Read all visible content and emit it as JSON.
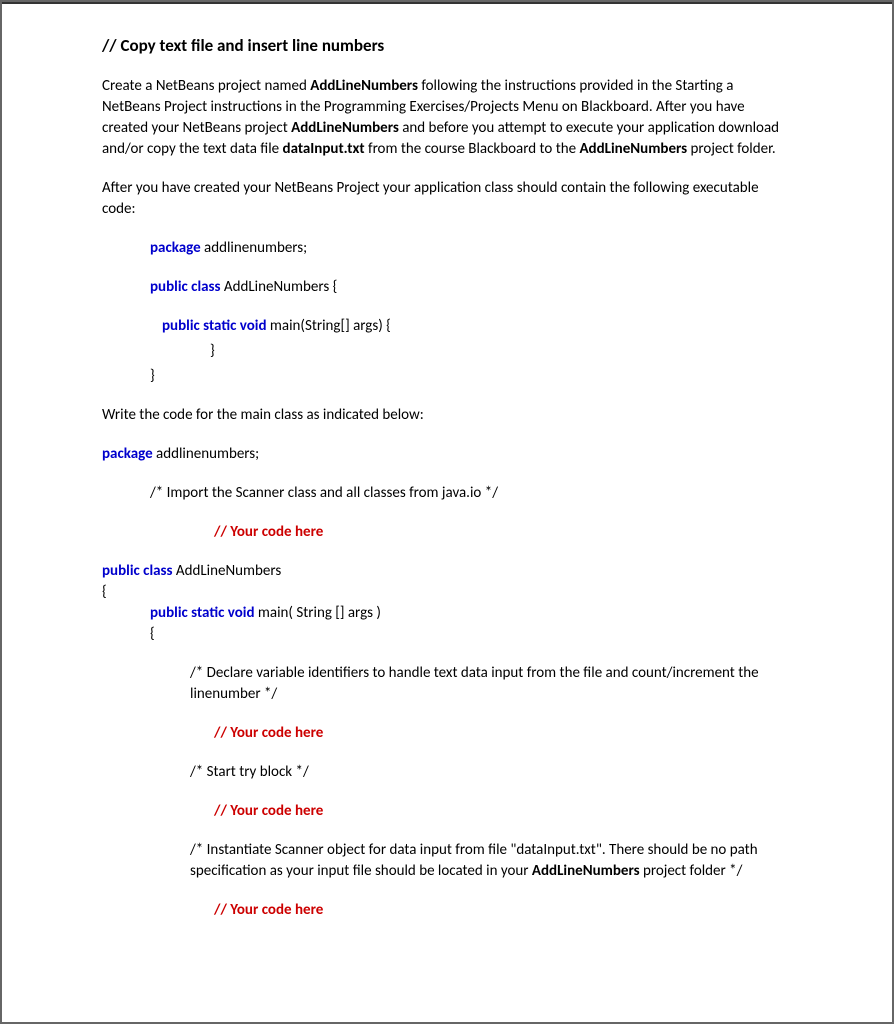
{
  "title": "// Copy text file and insert line numbers",
  "p1": {
    "s1a": "Create a NetBeans project named ",
    "s1b": "AddLineNumbers",
    "s1c": " following the instructions provided in the Starting a NetBeans Project instructions in the Programming Exercises/Projects Menu on Blackboard.  After you have created your NetBeans project ",
    "s1d": "AddLineNumbers",
    "s1e": " and before you attempt to execute your application download and/or copy the text data file ",
    "s1f": "dataInput.txt",
    "s1g": " from the course Blackboard to the ",
    "s1h": "AddLineNumbers",
    "s1i": " project folder."
  },
  "p2": "After you have created your NetBeans Project your application class should contain the following executable code:",
  "code1": {
    "l1a": "package",
    "l1b": " addlinenumbers;",
    "l2a": "public class",
    "l2b": " AddLineNumbers {",
    "l3a": "public static void",
    "l3b": " main(String[] args) {",
    "l4": "}",
    "l5": "}"
  },
  "p3": "Write the code for the main class as indicated below:",
  "code2": {
    "pkg_a": "package",
    "pkg_b": " addlinenumbers;",
    "c1": "/*  Import the Scanner class and all classes from java.io */",
    "yc": "// Your code here",
    "cls_a": "public class",
    "cls_b": " AddLineNumbers",
    "brace_open": "{",
    "main_a": "public static void",
    "main_b": " main( String [] args )",
    "brace_open2": "{",
    "c2": "/*  Declare variable identifiers to handle text data input from the file and count/increment the linenumber */",
    "c3": "/*  Start try block */",
    "c4_a": "/*   Instantiate Scanner object for data input from file \"dataInput.txt\".  There should be no path specification as your input file should be located in your ",
    "c4_b": "AddLineNumbers",
    "c4_c": "  project folder */"
  }
}
